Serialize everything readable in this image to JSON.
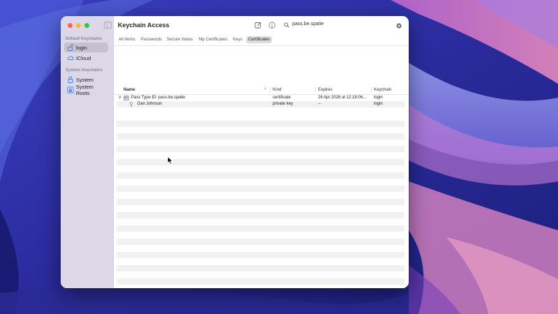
{
  "app": {
    "title": "Keychain Access"
  },
  "sidebar": {
    "default_header": "Default Keychains",
    "system_header": "System Keychains",
    "items": [
      {
        "label": "login",
        "icon": "unlocked-padlock-icon",
        "selected": true
      },
      {
        "label": "iCloud",
        "icon": "cloud-icon",
        "selected": false
      },
      {
        "label": "System",
        "icon": "padlock-icon",
        "selected": false
      },
      {
        "label": "System Roots",
        "icon": "padlock-box-icon",
        "selected": false
      }
    ]
  },
  "toolbar": {
    "compose_icon": "compose-icon",
    "info_icon": "info-icon"
  },
  "search": {
    "value": "pass.be.spatie",
    "icon": "search-icon",
    "clear_icon": "clear-icon"
  },
  "tabs": [
    {
      "label": "All Items",
      "active": false
    },
    {
      "label": "Passwords",
      "active": false
    },
    {
      "label": "Secure Notes",
      "active": false
    },
    {
      "label": "My Certificates",
      "active": false
    },
    {
      "label": "Keys",
      "active": false
    },
    {
      "label": "Certificates",
      "active": true
    }
  ],
  "table": {
    "columns": [
      "Name",
      "Kind",
      "Expires",
      "Keychain"
    ],
    "sort_indicator": "^",
    "rows": [
      {
        "disclosure": "v",
        "icon": "certificate-icon",
        "name": "Pass Type ID: pass.be.spatie",
        "kind": "certificate",
        "expires": "26 Apr 2026 at 12:18:06...",
        "keychain": "login"
      },
      {
        "icon": "key-icon",
        "name": "Dan Johnson",
        "kind": "private key",
        "expires": "--",
        "keychain": "login"
      }
    ]
  },
  "colors": {
    "sidebar_bg": "#ddd8e8",
    "selected_bg": "#c6c1cf",
    "accent_blue": "#3b82f6",
    "traffic_red": "#fe5f57",
    "traffic_yellow": "#febc2e",
    "traffic_green": "#28c840"
  }
}
